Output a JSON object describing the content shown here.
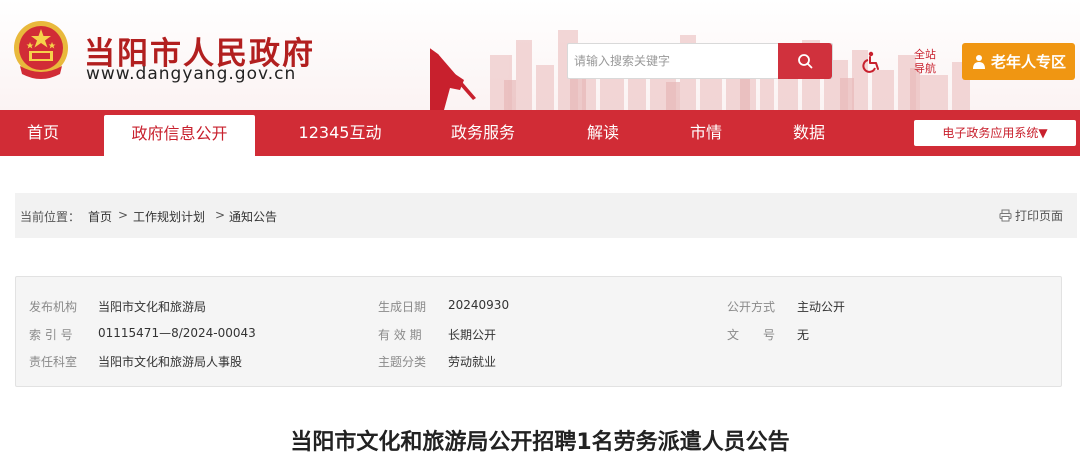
{
  "header": {
    "site_title": "当阳市人民政府",
    "site_domain": "www.dangyang.gov.cn",
    "search_placeholder": "请输入搜索关键字",
    "nav_guide_line1": "全站",
    "nav_guide_line2": "导航",
    "elder_label": "老年人专区",
    "accent_color": "#d12c36",
    "elder_color": "#f09612"
  },
  "nav": {
    "items": [
      {
        "label": "首页"
      },
      {
        "label": "政府信息公开"
      },
      {
        "label": "12345互动"
      },
      {
        "label": "政务服务"
      },
      {
        "label": "解读"
      },
      {
        "label": "市情"
      },
      {
        "label": "数据"
      }
    ],
    "active_index": 1,
    "service_select": "电子政务应用系统▼"
  },
  "breadcrumb": {
    "label": "当前位置：",
    "items": [
      "首页",
      "工作规划计划",
      "通知公告"
    ],
    "separator": ">",
    "print_label": "打印页面"
  },
  "meta": {
    "publisher_label": "发布机构",
    "publisher_value": "当阳市文化和旅游局",
    "date_label": "生成日期",
    "date_value": "20240930",
    "mode_label": "公开方式",
    "mode_value": "主动公开",
    "index_label": "索 引 号",
    "index_value": "01115471—8/2024-00043",
    "validity_label": "有 效 期",
    "validity_value": "长期公开",
    "docno_label": "文　　号",
    "docno_value": "无",
    "dept_label": "责任科室",
    "dept_value": "当阳市文化和旅游局人事股",
    "topic_label": "主题分类",
    "topic_value": "劳动就业"
  },
  "document": {
    "title": "当阳市文化和旅游局公开招聘1名劳务派遣人员公告"
  }
}
